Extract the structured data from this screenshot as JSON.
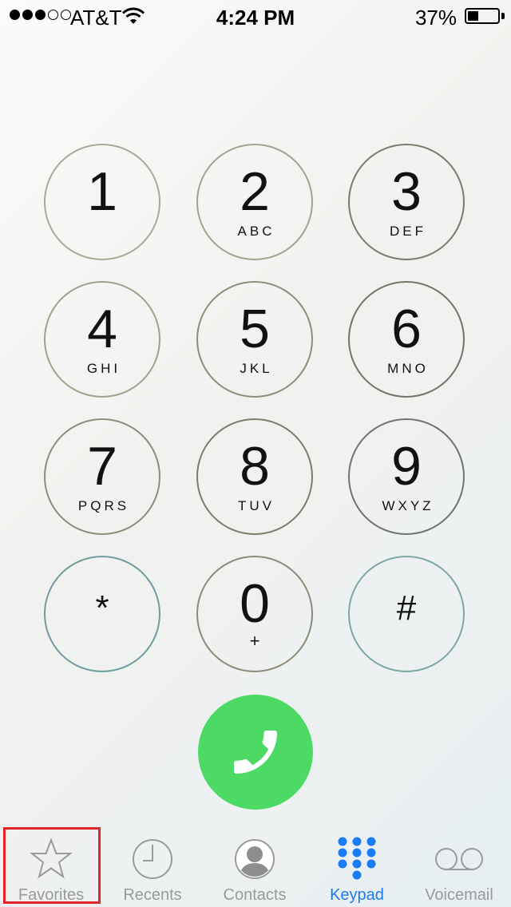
{
  "status_bar": {
    "signal_strength": "3 of 5",
    "carrier": "AT&T",
    "time": "4:24 PM",
    "battery_percent": "37%",
    "battery_level": 0.37
  },
  "keypad": {
    "keys": [
      {
        "digit": "1",
        "letters": ""
      },
      {
        "digit": "2",
        "letters": "ABC"
      },
      {
        "digit": "3",
        "letters": "DEF"
      },
      {
        "digit": "4",
        "letters": "GHI"
      },
      {
        "digit": "5",
        "letters": "JKL"
      },
      {
        "digit": "6",
        "letters": "MNO"
      },
      {
        "digit": "7",
        "letters": "PQRS"
      },
      {
        "digit": "8",
        "letters": "TUV"
      },
      {
        "digit": "9",
        "letters": "WXYZ"
      },
      {
        "digit": "*",
        "letters": ""
      },
      {
        "digit": "0",
        "letters": "+"
      },
      {
        "digit": "#",
        "letters": ""
      }
    ]
  },
  "call": {
    "icon": "phone-icon",
    "color": "#4cd964"
  },
  "tabs": [
    {
      "label": "Favorites",
      "icon": "star-icon",
      "active": false,
      "highlighted": true
    },
    {
      "label": "Recents",
      "icon": "clock-icon",
      "active": false
    },
    {
      "label": "Contacts",
      "icon": "person-icon",
      "active": false
    },
    {
      "label": "Keypad",
      "icon": "keypad-icon",
      "active": true
    },
    {
      "label": "Voicemail",
      "icon": "voicemail-icon",
      "active": false
    }
  ],
  "colors": {
    "accent": "#1a7cf5",
    "inactive_tab": "#9a9a9a",
    "call_green": "#4cd964",
    "highlight": "#e0262b"
  }
}
